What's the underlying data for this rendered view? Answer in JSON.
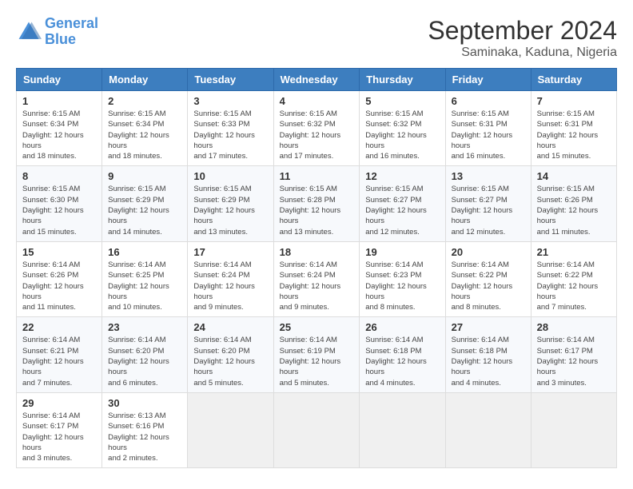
{
  "header": {
    "logo_line1": "General",
    "logo_line2": "Blue",
    "month": "September 2024",
    "location": "Saminaka, Kaduna, Nigeria"
  },
  "weekdays": [
    "Sunday",
    "Monday",
    "Tuesday",
    "Wednesday",
    "Thursday",
    "Friday",
    "Saturday"
  ],
  "weeks": [
    [
      {
        "day": "1",
        "sunrise": "6:15 AM",
        "sunset": "6:34 PM",
        "daylight": "12 hours and 18 minutes."
      },
      {
        "day": "2",
        "sunrise": "6:15 AM",
        "sunset": "6:34 PM",
        "daylight": "12 hours and 18 minutes."
      },
      {
        "day": "3",
        "sunrise": "6:15 AM",
        "sunset": "6:33 PM",
        "daylight": "12 hours and 17 minutes."
      },
      {
        "day": "4",
        "sunrise": "6:15 AM",
        "sunset": "6:32 PM",
        "daylight": "12 hours and 17 minutes."
      },
      {
        "day": "5",
        "sunrise": "6:15 AM",
        "sunset": "6:32 PM",
        "daylight": "12 hours and 16 minutes."
      },
      {
        "day": "6",
        "sunrise": "6:15 AM",
        "sunset": "6:31 PM",
        "daylight": "12 hours and 16 minutes."
      },
      {
        "day": "7",
        "sunrise": "6:15 AM",
        "sunset": "6:31 PM",
        "daylight": "12 hours and 15 minutes."
      }
    ],
    [
      {
        "day": "8",
        "sunrise": "6:15 AM",
        "sunset": "6:30 PM",
        "daylight": "12 hours and 15 minutes."
      },
      {
        "day": "9",
        "sunrise": "6:15 AM",
        "sunset": "6:29 PM",
        "daylight": "12 hours and 14 minutes."
      },
      {
        "day": "10",
        "sunrise": "6:15 AM",
        "sunset": "6:29 PM",
        "daylight": "12 hours and 13 minutes."
      },
      {
        "day": "11",
        "sunrise": "6:15 AM",
        "sunset": "6:28 PM",
        "daylight": "12 hours and 13 minutes."
      },
      {
        "day": "12",
        "sunrise": "6:15 AM",
        "sunset": "6:27 PM",
        "daylight": "12 hours and 12 minutes."
      },
      {
        "day": "13",
        "sunrise": "6:15 AM",
        "sunset": "6:27 PM",
        "daylight": "12 hours and 12 minutes."
      },
      {
        "day": "14",
        "sunrise": "6:15 AM",
        "sunset": "6:26 PM",
        "daylight": "12 hours and 11 minutes."
      }
    ],
    [
      {
        "day": "15",
        "sunrise": "6:14 AM",
        "sunset": "6:26 PM",
        "daylight": "12 hours and 11 minutes."
      },
      {
        "day": "16",
        "sunrise": "6:14 AM",
        "sunset": "6:25 PM",
        "daylight": "12 hours and 10 minutes."
      },
      {
        "day": "17",
        "sunrise": "6:14 AM",
        "sunset": "6:24 PM",
        "daylight": "12 hours and 9 minutes."
      },
      {
        "day": "18",
        "sunrise": "6:14 AM",
        "sunset": "6:24 PM",
        "daylight": "12 hours and 9 minutes."
      },
      {
        "day": "19",
        "sunrise": "6:14 AM",
        "sunset": "6:23 PM",
        "daylight": "12 hours and 8 minutes."
      },
      {
        "day": "20",
        "sunrise": "6:14 AM",
        "sunset": "6:22 PM",
        "daylight": "12 hours and 8 minutes."
      },
      {
        "day": "21",
        "sunrise": "6:14 AM",
        "sunset": "6:22 PM",
        "daylight": "12 hours and 7 minutes."
      }
    ],
    [
      {
        "day": "22",
        "sunrise": "6:14 AM",
        "sunset": "6:21 PM",
        "daylight": "12 hours and 7 minutes."
      },
      {
        "day": "23",
        "sunrise": "6:14 AM",
        "sunset": "6:20 PM",
        "daylight": "12 hours and 6 minutes."
      },
      {
        "day": "24",
        "sunrise": "6:14 AM",
        "sunset": "6:20 PM",
        "daylight": "12 hours and 5 minutes."
      },
      {
        "day": "25",
        "sunrise": "6:14 AM",
        "sunset": "6:19 PM",
        "daylight": "12 hours and 5 minutes."
      },
      {
        "day": "26",
        "sunrise": "6:14 AM",
        "sunset": "6:18 PM",
        "daylight": "12 hours and 4 minutes."
      },
      {
        "day": "27",
        "sunrise": "6:14 AM",
        "sunset": "6:18 PM",
        "daylight": "12 hours and 4 minutes."
      },
      {
        "day": "28",
        "sunrise": "6:14 AM",
        "sunset": "6:17 PM",
        "daylight": "12 hours and 3 minutes."
      }
    ],
    [
      {
        "day": "29",
        "sunrise": "6:14 AM",
        "sunset": "6:17 PM",
        "daylight": "12 hours and 3 minutes."
      },
      {
        "day": "30",
        "sunrise": "6:13 AM",
        "sunset": "6:16 PM",
        "daylight": "12 hours and 2 minutes."
      },
      null,
      null,
      null,
      null,
      null
    ]
  ]
}
